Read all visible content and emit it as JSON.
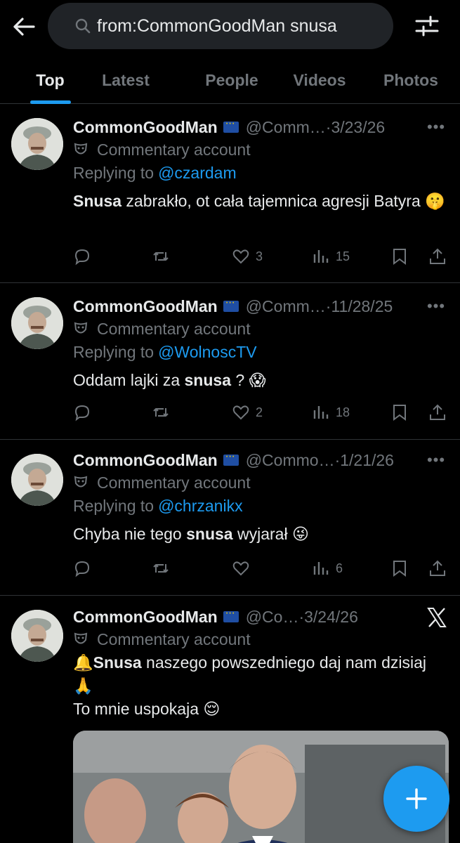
{
  "search": {
    "query": "from:CommonGoodMan snusa"
  },
  "tabs": [
    {
      "label": "Top",
      "active": true
    },
    {
      "label": "Latest",
      "active": false
    },
    {
      "label": "People",
      "active": false
    },
    {
      "label": "Videos",
      "active": false
    },
    {
      "label": "Photos",
      "active": false
    }
  ],
  "colors": {
    "accent": "#1d9bf0",
    "background": "#000000",
    "muted": "#71767b",
    "text": "#e7e9ea"
  },
  "tweets": [
    {
      "name": "CommonGoodMan",
      "handle": "@Comm…",
      "dot": "·",
      "date": "3/23/26",
      "commentary": "Commentary account",
      "reply_prefix": "Replying to",
      "reply_to": "@czardam",
      "text_bold": "Snusa",
      "text_rest": " zabrakło, ot cała tajemnica agresji Batyra",
      "emoji": "🤫",
      "likes": "3",
      "views": "15"
    },
    {
      "name": "CommonGoodMan",
      "handle": "@Comm…",
      "dot": "·",
      "date": "11/28/25",
      "commentary": "Commentary account",
      "reply_prefix": "Replying to",
      "reply_to": "@WolnoscTV",
      "text_pre": "Oddam lajki za ",
      "text_bold": "snusa",
      "text_rest": " ? ",
      "emoji": "😱",
      "likes": "2",
      "views": "18"
    },
    {
      "name": "CommonGoodMan",
      "handle": "@Commo…",
      "dot": "·",
      "date": "1/21/26",
      "commentary": "Commentary account",
      "reply_prefix": "Replying to",
      "reply_to": "@chrzanikx",
      "text_pre": "Chyba nie tego ",
      "text_bold": "snusa",
      "text_rest": " wyjarał ",
      "emoji": "😜",
      "likes": "",
      "views": "6"
    },
    {
      "name": "CommonGoodMan",
      "handle": "@Co…",
      "dot": "·",
      "date": "3/24/26",
      "commentary": "Commentary account",
      "emoji_pre": "🔔",
      "text_bold": "Snusa",
      "text_rest": " naszego powszedniego daj nam dzisiaj ",
      "emoji_mid": "🙏",
      "text_line2": "To mnie uspokaja ",
      "emoji_end": "😌"
    }
  ]
}
